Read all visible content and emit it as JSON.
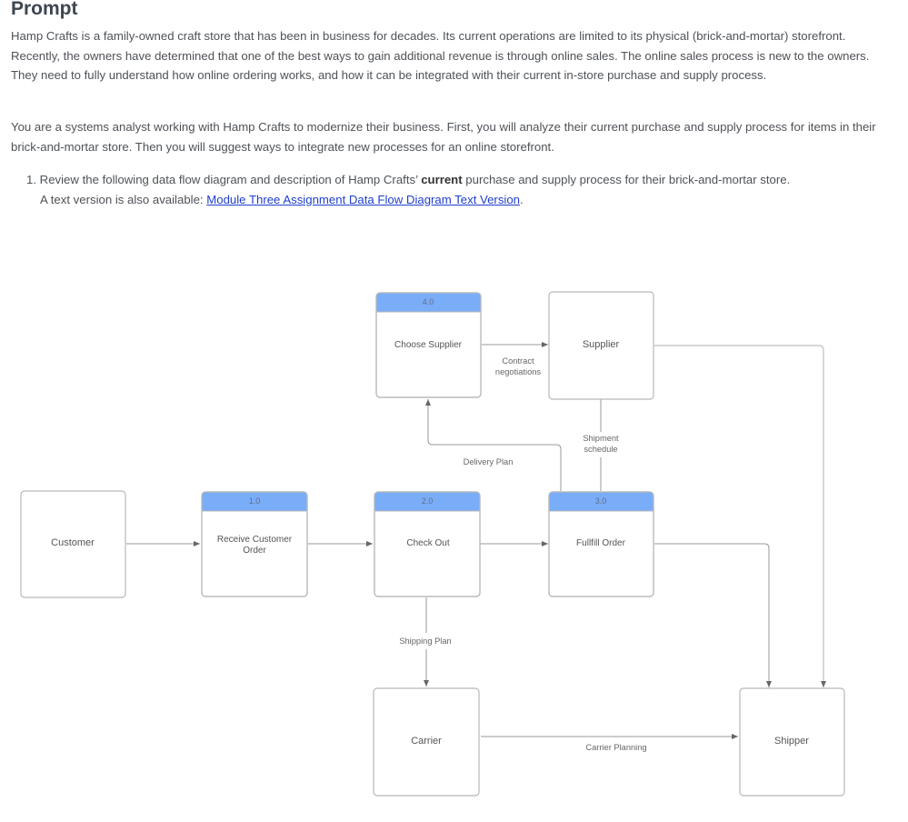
{
  "page": {
    "title": "Prompt",
    "paragraphs": [
      "Hamp Crafts is a family-owned craft store that has been in business for decades. Its current operations are limited to its physical (brick-and-mortar) storefront. Recently, the owners have determined that one of the best ways to gain additional revenue is through online sales. The online sales process is new to the owners. They need to fully understand how online ordering works, and how it can be integrated with their current in-store purchase and supply process.",
      "You are a systems analyst working with Hamp Crafts to modernize their business. First, you will analyze their current purchase and supply process for items in their brick-and-mortar store. Then you will suggest ways to integrate new processes for an online storefront."
    ],
    "list_item": {
      "number": "1.",
      "text_before": "Review the following data flow diagram and description of Hamp Crafts’ ",
      "bold": "current",
      "text_after": " purchase and supply process for their brick-and-mortar store.",
      "line2_prefix": "A text version is also available: ",
      "link_text": "Module Three Assignment Data Flow Diagram Text Version",
      "line2_suffix": "."
    }
  },
  "diagram": {
    "colors": {
      "process_header": "#7aadf8",
      "border": "#b8b8b8",
      "link": "#1f3fcc"
    },
    "processes": [
      {
        "id": "p1",
        "number": "1.0",
        "label_lines": [
          "Receive Customer",
          "Order"
        ]
      },
      {
        "id": "p2",
        "number": "2.0",
        "label_lines": [
          "Check Out"
        ]
      },
      {
        "id": "p3",
        "number": "3.0",
        "label_lines": [
          "Fullfill Order"
        ]
      },
      {
        "id": "p4",
        "number": "4.0",
        "label_lines": [
          "Choose Supplier"
        ]
      }
    ],
    "entities": [
      {
        "id": "customer",
        "label": "Customer"
      },
      {
        "id": "supplier",
        "label": "Supplier"
      },
      {
        "id": "carrier",
        "label": "Carrier"
      },
      {
        "id": "shipper",
        "label": "Shipper"
      }
    ],
    "flows": [
      {
        "from": "customer",
        "to": "p1",
        "label_lines": []
      },
      {
        "from": "p1",
        "to": "p2",
        "label_lines": []
      },
      {
        "from": "p2",
        "to": "p3",
        "label_lines": []
      },
      {
        "from": "p4",
        "to": "supplier",
        "label_lines": [
          "Contract",
          "negotiations"
        ]
      },
      {
        "from": "supplier",
        "to": "p3",
        "label_lines": [
          "Shipment",
          "schedule"
        ]
      },
      {
        "from": "p3",
        "to": "p4",
        "label_lines": [
          "Delivery Plan"
        ]
      },
      {
        "from": "p2",
        "to": "carrier",
        "label_lines": [
          "Shipping Plan"
        ]
      },
      {
        "from": "carrier",
        "to": "shipper",
        "label_lines": [
          "Carrier Planning"
        ]
      },
      {
        "from": "p3",
        "to": "shipper",
        "label_lines": []
      },
      {
        "from": "supplier",
        "to": "shipper",
        "label_lines": []
      }
    ]
  }
}
